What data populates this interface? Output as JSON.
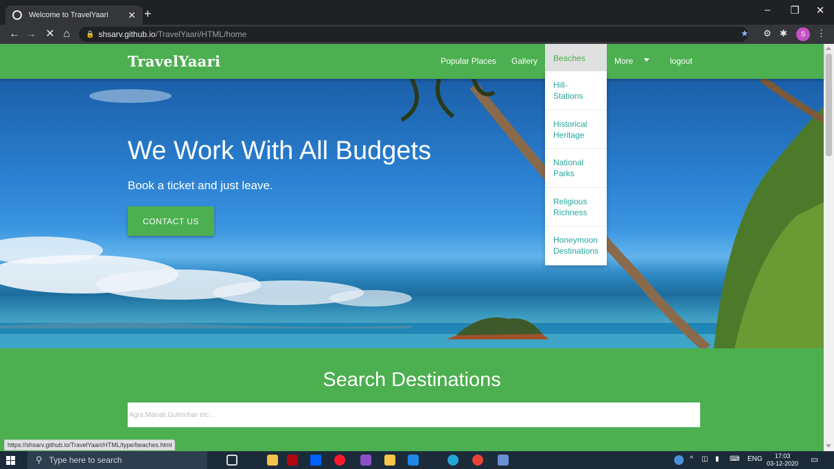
{
  "browser": {
    "tab_title": "Welcome to TravelYaari",
    "tab_close": "✕",
    "new_tab": "+",
    "favicon": "((•))",
    "url_host": "shsarv.github.io",
    "url_path": "/TravelYaari/HTML/home",
    "profile_initial": "S",
    "status_url": "https://shsarv.github.io/TravelYaari/HTML/type/beaches.html",
    "window_controls": {
      "minimize": "–",
      "maximize": "❐",
      "close": "✕"
    },
    "nav": {
      "back": "←",
      "forward": "→",
      "stop": "✕",
      "home": "⌂"
    }
  },
  "site": {
    "brand": "TravelYaari",
    "nav": {
      "popular": "Popular Places",
      "gallery": "Gallery",
      "beaches": "Beaches",
      "more": "More",
      "logout": "logout"
    },
    "dropdown": [
      "Hill-\nStations",
      "Historical\nHeritage",
      "National\nParks",
      "Religious\nRichness",
      "Honeymoon\nDestinations"
    ],
    "hero": {
      "heading": "We Work With All Budgets",
      "subheading": "Book a ticket and just leave.",
      "button": "CONTACT US"
    },
    "search": {
      "title": "Search Destinations",
      "placeholder": "Agra,Manali,Gulmohar etc..."
    },
    "colors": {
      "primary": "#4caf50",
      "dropdown_text": "#26a69a"
    }
  },
  "taskbar": {
    "search_placeholder": "Type here to search",
    "language": "ENG",
    "time": "17:03",
    "date": "03-12-2020",
    "apps": [
      "task-view",
      "file-explorer",
      "netflix",
      "dropbox",
      "opera",
      "ide",
      "store",
      "mail",
      "edge",
      "chrome",
      "notes"
    ]
  }
}
